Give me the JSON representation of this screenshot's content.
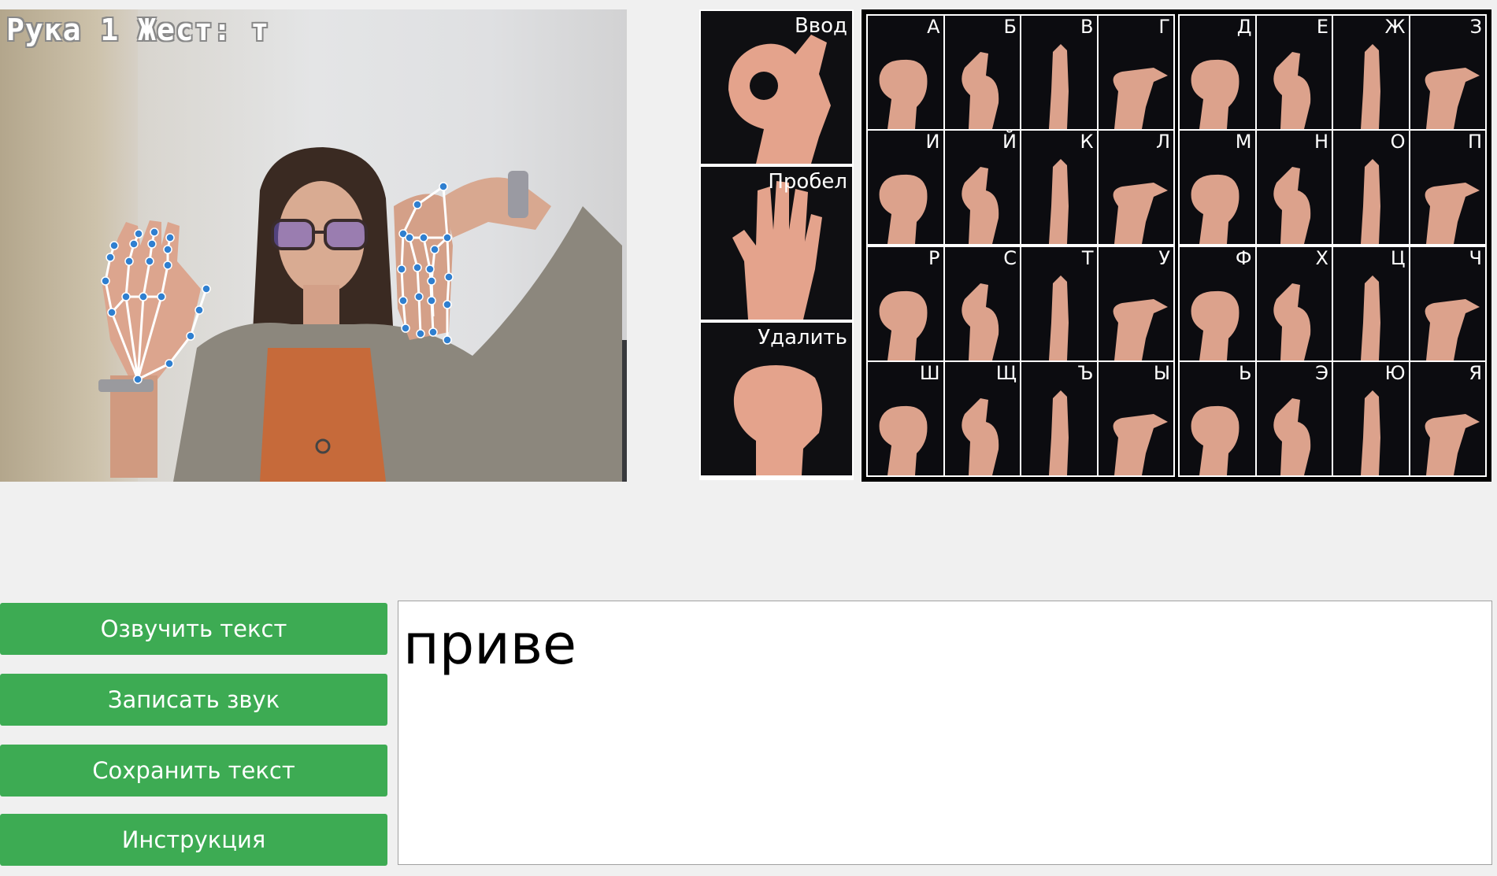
{
  "camera": {
    "overlay_text": "Рука 1 Жест: т"
  },
  "commands": [
    {
      "label": "Ввод"
    },
    {
      "label": "Пробел"
    },
    {
      "label": "Удалить"
    }
  ],
  "alphabet": {
    "letters": [
      "А",
      "Б",
      "В",
      "Г",
      "Д",
      "Е",
      "Ж",
      "З",
      "И",
      "Й",
      "К",
      "Л",
      "М",
      "Н",
      "О",
      "П",
      "Р",
      "С",
      "Т",
      "У",
      "Ф",
      "Х",
      "Ц",
      "Ч",
      "Ш",
      "Щ",
      "Ъ",
      "Ы",
      "Ь",
      "Э",
      "Ю",
      "Я"
    ]
  },
  "buttons": {
    "speak": "Озвучить текст",
    "record": "Записать звук",
    "save": "Сохранить текст",
    "instructions": "Инструкция"
  },
  "text_output": {
    "value": "приве"
  },
  "colors": {
    "button_green": "#3dab53",
    "landmark_blue": "#2f7fd0"
  }
}
